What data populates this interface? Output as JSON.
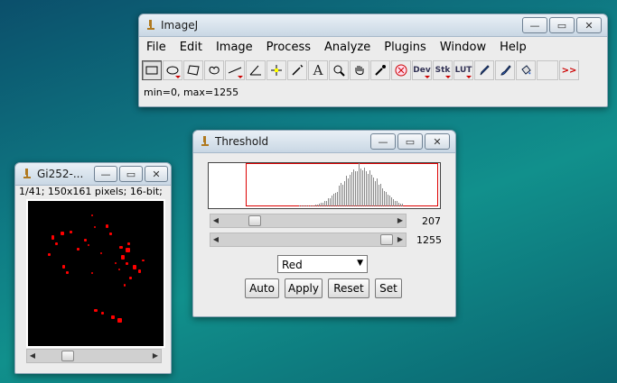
{
  "imagej": {
    "title": "ImageJ",
    "menus": [
      "File",
      "Edit",
      "Image",
      "Process",
      "Analyze",
      "Plugins",
      "Window",
      "Help"
    ],
    "tools": {
      "dev": "Dev",
      "stk": "Stk",
      "lut": "LUT",
      "more": ">>"
    },
    "status": "min=0, max=1255"
  },
  "threshold": {
    "title": "Threshold",
    "slider1_value": "207",
    "slider2_value": "1255",
    "mode": "Red",
    "buttons": {
      "auto": "Auto",
      "apply": "Apply",
      "reset": "Reset",
      "set": "Set"
    }
  },
  "image_window": {
    "title": "Gi252-...",
    "info": "1/41; 150x161 pixels; 16-bit;"
  },
  "window_buttons": {
    "minimize": "—",
    "maximize": "▭",
    "close": "✕"
  },
  "colors": {
    "threshold_red": "#ff0000",
    "desktop": "#0f7d85"
  }
}
